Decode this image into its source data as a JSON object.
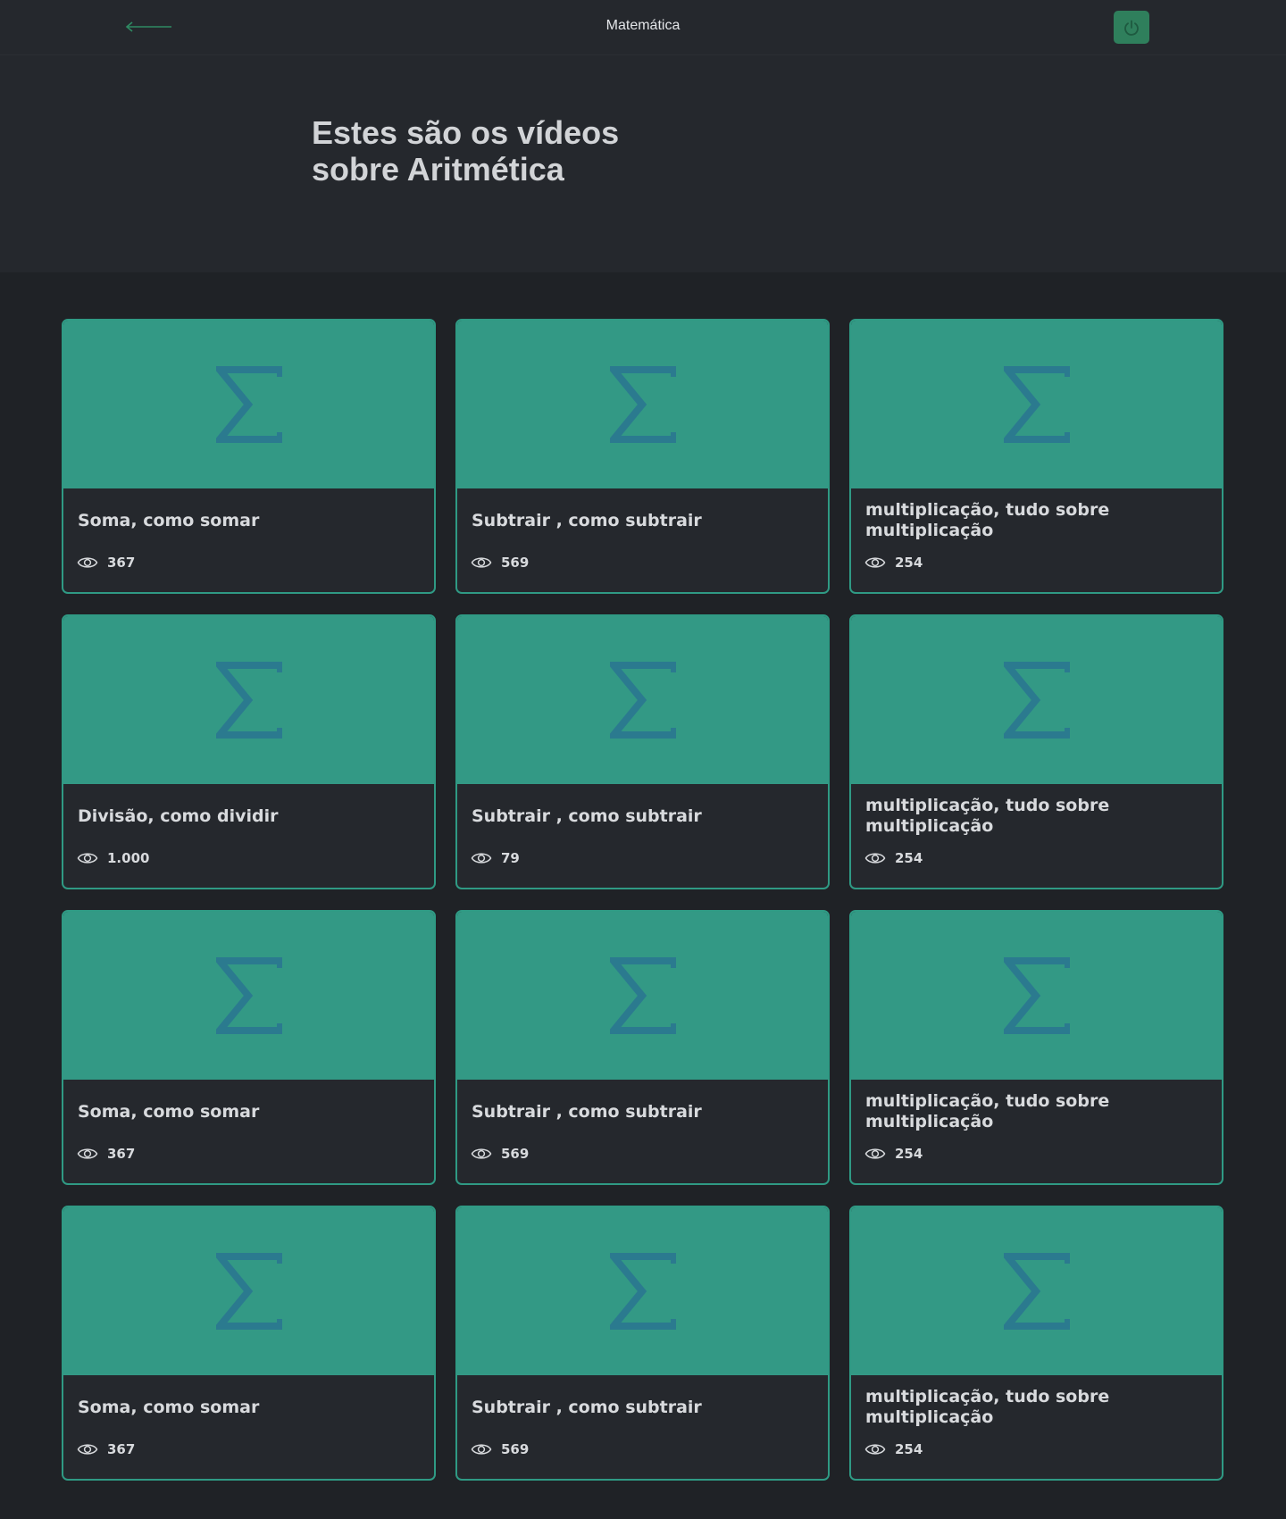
{
  "header": {
    "back_icon": "arrow-left-icon",
    "title": "Matemática",
    "logout_icon": "power-icon",
    "accent": "#2f7f5c"
  },
  "hero": {
    "title": "Estes são os vídeos sobre Aritmética"
  },
  "cards": [
    {
      "title": "Soma, como somar",
      "views": "367"
    },
    {
      "title": "Subtrair , como subtrair",
      "views": "569"
    },
    {
      "title": "multiplicação, tudo sobre multiplicação",
      "views": "254"
    },
    {
      "title": "Divisão, como dividir",
      "views": "1.000"
    },
    {
      "title": "Subtrair , como subtrair",
      "views": "79"
    },
    {
      "title": "multiplicação, tudo sobre multiplicação",
      "views": "254"
    },
    {
      "title": "Soma, como somar",
      "views": "367"
    },
    {
      "title": "Subtrair , como subtrair",
      "views": "569"
    },
    {
      "title": "multiplicação, tudo sobre multiplicação",
      "views": "254"
    },
    {
      "title": "Soma, como somar",
      "views": "367"
    },
    {
      "title": "Subtrair , como subtrair",
      "views": "569"
    },
    {
      "title": "multiplicação, tudo sobre multiplicação",
      "views": "254"
    }
  ],
  "colors": {
    "thumbnail": "#339985",
    "sigma": "#2b7a8f",
    "card_border": "#2f9a84"
  },
  "icons": {
    "thumbnail": "sigma-icon",
    "views": "eye-icon"
  }
}
